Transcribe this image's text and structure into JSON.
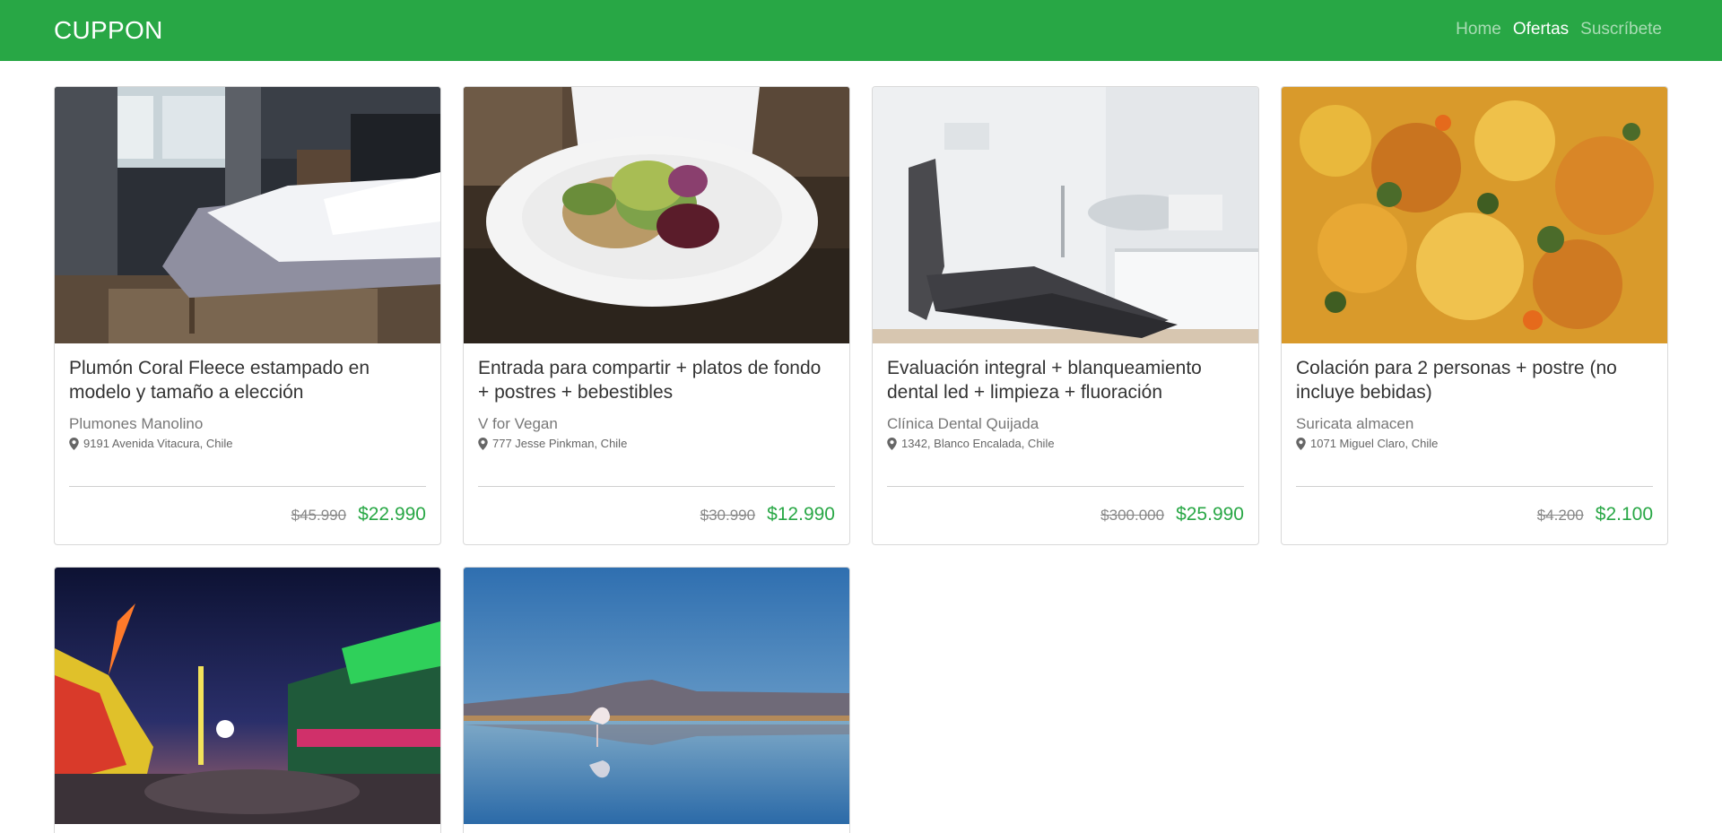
{
  "navbar": {
    "brand": "CUPPON",
    "links": [
      {
        "label": "Home",
        "active": false
      },
      {
        "label": "Ofertas",
        "active": true
      },
      {
        "label": "Suscríbete",
        "active": false
      }
    ]
  },
  "offers": [
    {
      "title": "Plumón Coral Fleece estampado en modelo y tamaño a elección",
      "merchant": "Plumones Manolino",
      "address": "9191 Avenida Vitacura, Chile",
      "old_price": "$45.990",
      "new_price": "$22.990",
      "image": "bedroom-photo"
    },
    {
      "title": "Entrada para compartir + platos de fondo + postres + bebestibles",
      "merchant": "V for Vegan",
      "address": "777 Jesse Pinkman, Chile",
      "old_price": "$30.990",
      "new_price": "$12.990",
      "image": "salad-plate-photo"
    },
    {
      "title": "Evaluación integral + blanqueamiento dental led + limpieza + fluoración",
      "merchant": "Clínica Dental Quijada",
      "address": "1342, Blanco Encalada, Chile",
      "old_price": "$300.000",
      "new_price": "$25.990",
      "image": "dental-chair-photo"
    },
    {
      "title": "Colación para 2 personas + postre (no incluye bebidas)",
      "merchant": "Suricata almacen",
      "address": "1071 Miguel Claro, Chile",
      "old_price": "$4.200",
      "new_price": "$2.100",
      "image": "vegetable-dish-photo"
    },
    {
      "image": "fairground-night-photo"
    },
    {
      "image": "flamingo-lake-photo"
    }
  ],
  "colors": {
    "brand_green": "#28a745",
    "price_green": "#28a745"
  }
}
